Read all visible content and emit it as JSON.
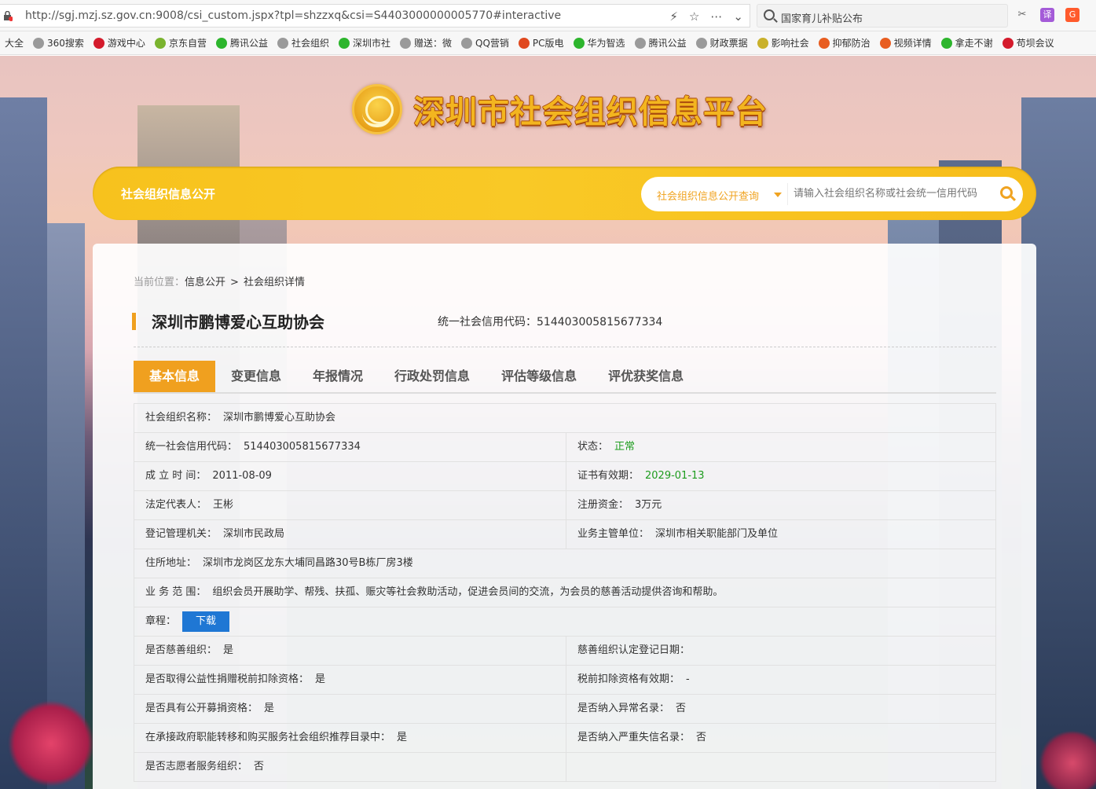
{
  "browser": {
    "url": "http://sgj.mzj.sz.gov.cn:9008/csi_custom.jspx?tpl=shzzxq&csi=S4403000000005770#interactive",
    "search_text": "国家育儿补贴公布",
    "extension_translate": "译",
    "extension_game": "G"
  },
  "bookmarks": [
    {
      "label": "大全",
      "color": "#e85d3c"
    },
    {
      "label": "360搜索",
      "color": "#9a9a9a"
    },
    {
      "label": "游戏中心",
      "color": "#d41b2c"
    },
    {
      "label": "京东自营",
      "color": "#7ab32e"
    },
    {
      "label": "腾讯公益",
      "color": "#2db52d"
    },
    {
      "label": "社会组织",
      "color": "#9a9a9a"
    },
    {
      "label": "深圳市社",
      "color": "#2db52d"
    },
    {
      "label": "赠送：微",
      "color": "#9a9a9a"
    },
    {
      "label": "QQ营销",
      "color": "#9a9a9a"
    },
    {
      "label": "PC版电",
      "color": "#e0491f"
    },
    {
      "label": "华为智选",
      "color": "#2db52d"
    },
    {
      "label": "腾讯公益",
      "color": "#9a9a9a"
    },
    {
      "label": "财政票据",
      "color": "#9a9a9a"
    },
    {
      "label": "影响社会",
      "color": "#c9b12b"
    },
    {
      "label": "抑郁防治",
      "color": "#e85d20"
    },
    {
      "label": "视频详情",
      "color": "#e85d20"
    },
    {
      "label": "拿走不谢",
      "color": "#2db52d"
    },
    {
      "label": "苟坝会议",
      "color": "#d41b2c"
    }
  ],
  "site": {
    "title": "深圳市社会组织信息平台",
    "bar_title": "社会组织信息公开",
    "search_select": "社会组织信息公开查询",
    "search_placeholder": "请输入社会组织名称或社会统一信用代码"
  },
  "breadcrumb": {
    "prefix": "当前位置：",
    "items": [
      "信息公开",
      "社会组织详情"
    ],
    "separator": ">"
  },
  "org": {
    "name": "深圳市鹏博爱心互助协会",
    "code_label": "统一社会信用代码：",
    "code": "514403005815677334"
  },
  "tabs": [
    "基本信息",
    "变更信息",
    "年报情况",
    "行政处罚信息",
    "评估等级信息",
    "评优获奖信息"
  ],
  "active_tab": 0,
  "info": {
    "name_label": "社会组织名称：",
    "name_value": "深圳市鹏博爱心互助协会",
    "code_label": "统一社会信用代码：",
    "code_value": "514403005815677334",
    "status_label": "状态：",
    "status_value": "正常",
    "established_label": "成 立 时 间：",
    "established_value": "2011-08-09",
    "cert_label": "证书有效期：",
    "cert_value": "2029-01-13",
    "rep_label": "法定代表人：",
    "rep_value": "王彬",
    "capital_label": "注册资金：",
    "capital_value": "3万元",
    "authority_label": "登记管理机关：",
    "authority_value": "深圳市民政局",
    "supervisor_label": "业务主管单位：",
    "supervisor_value": "深圳市相关职能部门及单位",
    "address_label": "住所地址：",
    "address_value": "深圳市龙岗区龙东大埔同昌路30号B栋厂房3楼",
    "scope_label": "业 务 范 围：",
    "scope_value": "组织会员开展助学、帮残、扶孤、赈灾等社会救助活动，促进会员间的交流，为会员的慈善活动提供咨询和帮助。",
    "charter_label": "章程：",
    "charter_button": "下载",
    "charity_label": "是否慈善组织：",
    "charity_value": "是",
    "charity_date_label": "慈善组织认定登记日期：",
    "charity_date_value": "",
    "tax_label": "是否取得公益性捐赠税前扣除资格：",
    "tax_value": "是",
    "tax_valid_label": "税前扣除资格有效期：",
    "tax_valid_value": "-",
    "fundraise_label": "是否具有公开募捐资格：",
    "fundraise_value": "是",
    "abnormal_label": "是否纳入异常名录：",
    "abnormal_value": "否",
    "gov_label": "在承接政府职能转移和购买服务社会组织推荐目录中：",
    "gov_value": "是",
    "dishonest_label": "是否纳入严重失信名录：",
    "dishonest_value": "否",
    "volunteer_label": "是否志愿者服务组织：",
    "volunteer_value": "否"
  }
}
